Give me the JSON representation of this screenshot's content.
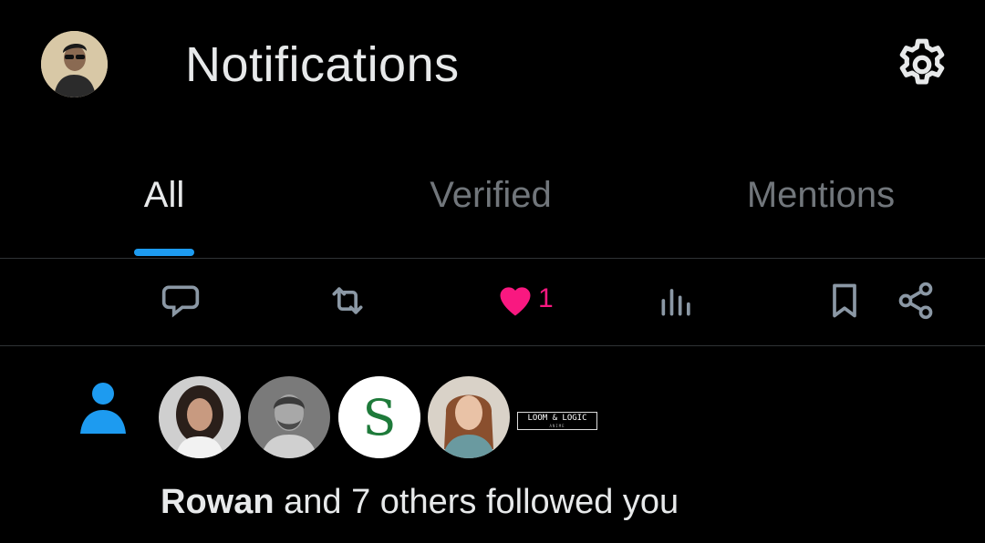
{
  "header": {
    "title": "Notifications",
    "settings_icon": "gear-icon"
  },
  "tabs": [
    {
      "label": "All",
      "active": true
    },
    {
      "label": "Verified",
      "active": false
    },
    {
      "label": "Mentions",
      "active": false
    }
  ],
  "accent_color": "#1d9bf0",
  "actions": {
    "reply_icon": "comment-icon",
    "repost_icon": "repost-icon",
    "like_icon": "heart-icon",
    "like_count": "1",
    "like_color": "#f91880",
    "views_icon": "bar-chart-icon",
    "bookmark_icon": "bookmark-icon",
    "share_icon": "share-icon"
  },
  "notification": {
    "type_icon": "person-icon",
    "follower_name": "Rowan",
    "follow_rest": " and 7 others followed you",
    "third_avatar_letter": "S",
    "brand_logo_text": "LOOM & LOGIC",
    "brand_logo_sub": "ANIME"
  }
}
